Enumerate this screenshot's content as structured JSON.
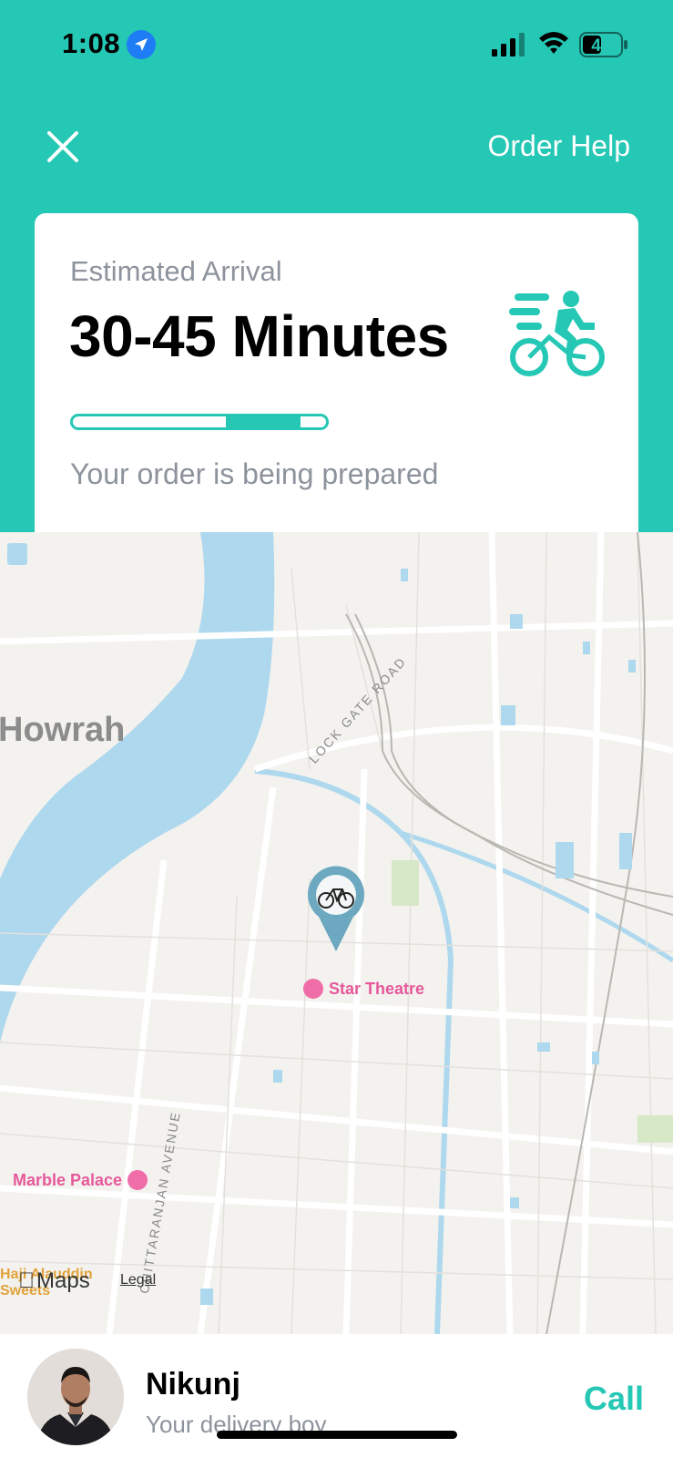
{
  "status_bar": {
    "time": "1:08",
    "battery": "44",
    "location_icon": "location-arrow-icon",
    "signal_icon": "cellular-signal-icon",
    "wifi_icon": "wifi-icon"
  },
  "header": {
    "close_icon": "close-icon",
    "order_help_label": "Order Help"
  },
  "card": {
    "eta_label": "Estimated Arrival",
    "eta_value": "30-45 Minutes",
    "rider_icon": "bike-rider-icon",
    "progress": {
      "segments": 3,
      "active_segment": 2
    },
    "status_text": "Your order is being prepared"
  },
  "map": {
    "labels": {
      "city": "Howrah",
      "road1": "LOCK GATE ROAD",
      "road2": "CHITTARANJAN AVENUE"
    },
    "pois": {
      "star_theatre": "Star Theatre",
      "marble_palace": "Marble Palace",
      "sweets": "Haji Alauddin Sweets"
    },
    "pin_icon": "bicycle-pin-icon",
    "brand": "Maps",
    "legal": "Legal"
  },
  "delivery": {
    "name": "Nikunj",
    "role": "Your delivery boy",
    "call_label": "Call"
  },
  "colors": {
    "accent": "#25C7B5",
    "muted_text": "#8D939C",
    "water": "#AED8EE",
    "map_bg": "#F3F2EE",
    "poi_pink": "#E6589A"
  }
}
